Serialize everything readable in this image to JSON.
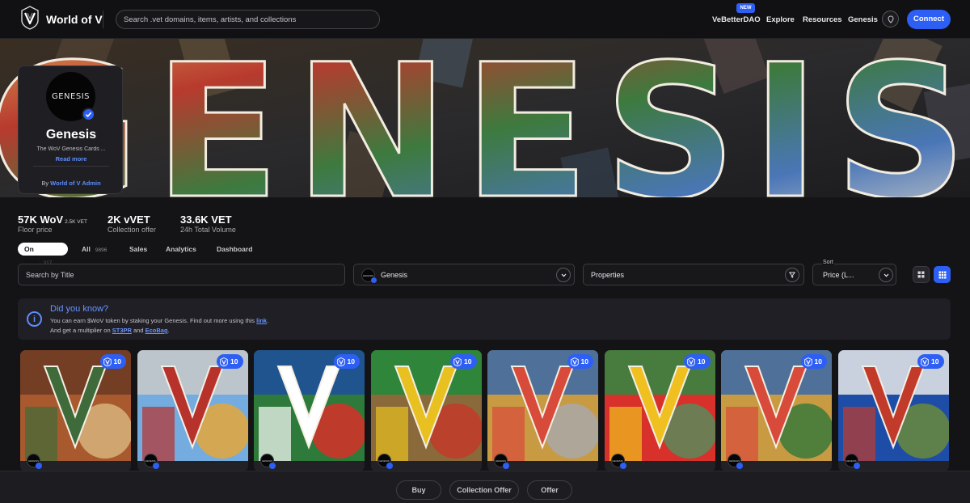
{
  "header": {
    "logo_text": "World of V",
    "search_placeholder": "Search .vet domains, items, artists, and collections",
    "nav": [
      {
        "label": "VeBetterDAO",
        "badge": "NEW"
      },
      {
        "label": "Explore"
      },
      {
        "label": "Resources"
      },
      {
        "label": "Genesis"
      }
    ],
    "connect_label": "Connect"
  },
  "banner": {
    "word": "GENESIS"
  },
  "collection": {
    "avatar_text": "GENESIS",
    "name": "Genesis",
    "description": "The WoV Genesis Cards ...",
    "read_more": "Read more",
    "by_prefix": "By",
    "by_name": "World of V Admin"
  },
  "stats": [
    {
      "value": "57K WoV",
      "extra": "2.5K VET",
      "label": "Floor price"
    },
    {
      "value": "2K vVET",
      "extra": "",
      "label": "Collection offer"
    },
    {
      "value": "33.6K VET",
      "extra": "",
      "label": "24h Total Volume"
    }
  ],
  "tabs": [
    {
      "label": "On Sale",
      "count": "317",
      "active": true
    },
    {
      "label": "All",
      "count": "9896",
      "active": false
    },
    {
      "label": "Sales",
      "count": "",
      "active": false
    },
    {
      "label": "Analytics",
      "count": "",
      "active": false
    },
    {
      "label": "Dashboard",
      "count": "",
      "active": false
    }
  ],
  "filters": {
    "title_search_placeholder": "Search by Title",
    "collection_value": "Genesis",
    "collection_avatar_text": "GENESIS",
    "properties_label": "Properties",
    "sort_label": "Sort",
    "sort_value": "Price (L..."
  },
  "info": {
    "title": "Did you know?",
    "line1_text": "You can earn $WoV token by staking your Genesis. Find out more using this",
    "line1_link": "link",
    "line1_end": ".",
    "line2_text": "And get a multiplier on",
    "line2_link1": "ST3PR",
    "line2_and": "and",
    "line2_link2": "EcoBag",
    "line2_end": "."
  },
  "cards": [
    {
      "badge": "10",
      "avatar_text": "GENESIS",
      "colors": [
        "#a85a2e",
        "#6b3a22",
        "#3f6b3a",
        "#d8b37a"
      ]
    },
    {
      "badge": "10",
      "avatar_text": "GENESIS",
      "colors": [
        "#74acdf",
        "#c9c9c9",
        "#b8322c",
        "#e5a73a"
      ]
    },
    {
      "badge": "10",
      "avatar_text": "GENESIS",
      "colors": [
        "#2d7a3a",
        "#1e4d9e",
        "#ffffff",
        "#d8302a"
      ]
    },
    {
      "badge": "10",
      "avatar_text": "GENESIS",
      "colors": [
        "#8a6a3a",
        "#1e8a3a",
        "#e8c020",
        "#c23a2a"
      ]
    },
    {
      "badge": "10",
      "avatar_text": "GENESIS",
      "colors": [
        "#c89a42",
        "#3a6aa8",
        "#d84a3a",
        "#a8a8a8"
      ]
    },
    {
      "badge": "10",
      "avatar_text": "GENESIS",
      "colors": [
        "#d8302a",
        "#2e8a42",
        "#f0c020",
        "#5a8a5a"
      ]
    },
    {
      "badge": "10",
      "avatar_text": "GENESIS",
      "colors": [
        "#c89a42",
        "#3a6aa8",
        "#d84a3a",
        "#3a7a3a"
      ]
    },
    {
      "badge": "10",
      "avatar_text": "GENESIS",
      "colors": [
        "#1e4da8",
        "#e8e8e8",
        "#c23a2a",
        "#6a8a3a"
      ]
    }
  ],
  "actions": {
    "buy": "Buy",
    "collection_offer": "Collection Offer",
    "offer": "Offer"
  },
  "colors": {
    "accent": "#2d5ff5",
    "link": "#5c8cff",
    "background": "#141416"
  },
  "icons": [
    "v-logo-icon",
    "wallet-icon",
    "verified-icon",
    "chevron-down-icon",
    "filter-icon",
    "grid-icon",
    "dense-grid-icon",
    "info-icon",
    "vet-token-icon"
  ]
}
